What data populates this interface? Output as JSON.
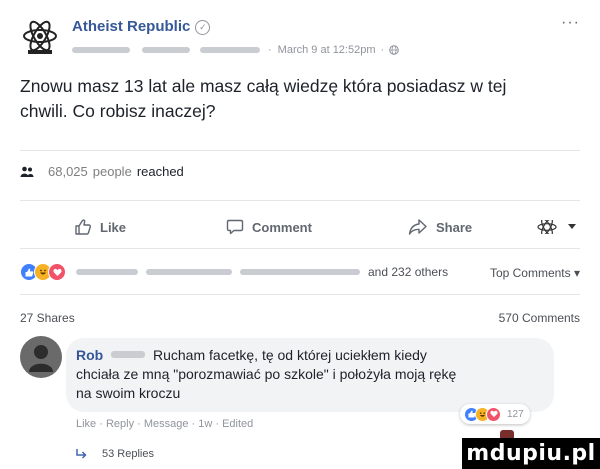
{
  "post": {
    "page_name": "Atheist Republic",
    "verified_glyph": "✓",
    "more_glyph": "···",
    "date": "March 9 at 12:52pm",
    "date_separator": "·",
    "icons": [
      "atom-logo-avatar",
      "globe-icon",
      "more-options-icon"
    ],
    "text_line1": "Znowu masz 13 lat ale masz całą wiedzę która posiadasz w tej",
    "text_line2": "chwili. Co robisz inaczej?"
  },
  "reach": {
    "count": "68,025",
    "people_label": "people",
    "reached_label": "reached"
  },
  "actions": {
    "like": "Like",
    "comment": "Comment",
    "share": "Share"
  },
  "reactions": {
    "others_label": "and 232 others",
    "top_comments_label": "Top Comments ▾",
    "colors": {
      "like": "#4080ff",
      "haha": "#f7b125",
      "love": "#f25268"
    }
  },
  "stats": {
    "shares": "27 Shares",
    "comments": "570 Comments"
  },
  "comment": {
    "author": "Rob",
    "text_line1": "Rucham facetkę, tę od której uciekłem kiedy",
    "text_line2": "chciała ze mną \"porozmawiać po szkole\" i położyła moją rękę",
    "text_line3": "na swoim kroczu",
    "actions_text": "Like · Reply · Message · 1w · Edited",
    "reaction_count": "127",
    "replies_label": "53 Replies"
  },
  "watermark": {
    "text": "mdupiu.pl"
  }
}
